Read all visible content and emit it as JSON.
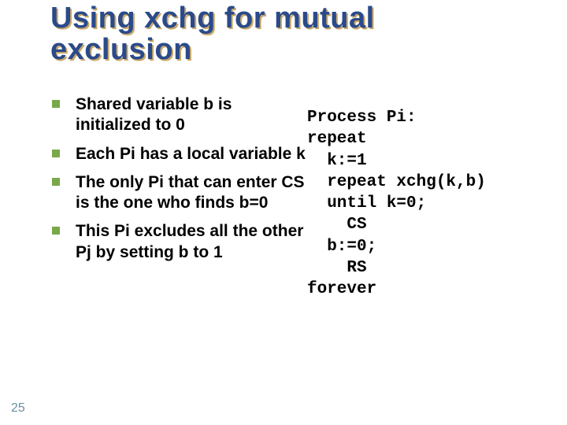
{
  "title": "Using xchg for mutual\nexclusion",
  "bullets": [
    "Shared variable b is initialized to 0",
    "Each Pi has a local variable k",
    "The only Pi that can enter CS is the one who finds b=0",
    "This Pi excludes all the other Pj by setting b to 1"
  ],
  "code": "Process Pi:\nrepeat\n  k:=1\n  repeat xchg(k,b)\n  until k=0;\n    CS\n  b:=0;\n    RS\nforever",
  "pageNumber": "25"
}
